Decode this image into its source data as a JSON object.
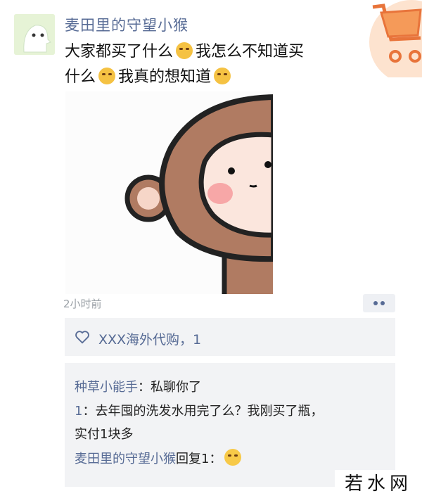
{
  "post": {
    "author": "麦田里的守望小猴",
    "text_line1": "大家都买了什么",
    "text_line1b": "我怎么不知道买",
    "text_line2": "什么",
    "text_line2b": "我真的想知道",
    "time": "2小时前"
  },
  "likes": {
    "names": "XXX海外代购，1"
  },
  "comments": [
    {
      "name": "种草小能手",
      "sep": "：",
      "text": "私聊你了"
    },
    {
      "name": "1",
      "sep": "：",
      "text": "去年囤的洗发水用完了么？我刚买了瓶，",
      "text2": "实付1块多"
    },
    {
      "name": "麦田里的守望小猴",
      "reply": "回复",
      "target": "1",
      "sep": "："
    }
  ],
  "watermark": "若水网",
  "colors": {
    "link": "#576b95",
    "panel": "#f2f3f5",
    "monkey": "#b07b62",
    "blush": "#f7a7a7"
  }
}
